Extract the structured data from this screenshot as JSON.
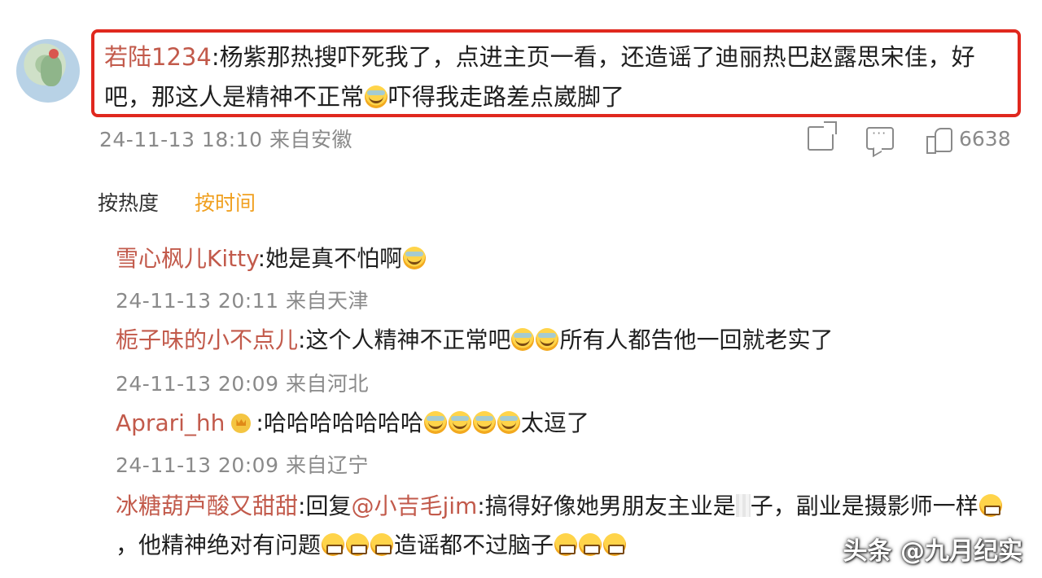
{
  "main_comment": {
    "username": "若陆1234",
    "text": ":杨紫那热搜吓死我了，点进主页一看，还造谣了迪丽热巴赵露思宋佳，好吧，那这人是精神不正常",
    "text_after_emoji": "吓得我走路差点崴脚了",
    "timestamp": "24-11-13 18:10",
    "location": "来自安徽",
    "like_count": "6638"
  },
  "sort": {
    "hot_label": "按热度",
    "time_label": "按时间"
  },
  "replies": [
    {
      "username": "雪心枫儿Kitty",
      "text": ":她是真不怕啊",
      "timestamp": "24-11-13 20:11",
      "location": "来自天津"
    },
    {
      "username": "栀子味的小不点儿",
      "text": ":这个人精神不正常吧",
      "text_after_emoji": "所有人都告他一回就老实了",
      "timestamp": "24-11-13 20:09",
      "location": "来自河北"
    },
    {
      "username": "Aprari_hh",
      "text": ":哈哈哈哈哈哈哈",
      "text_after_emoji": "太逗了",
      "timestamp": "24-11-13 20:09",
      "location": "来自辽宁"
    },
    {
      "username": "冰糖葫芦酸又甜甜",
      "text_part1": ":回复",
      "mention": "@小吉毛jim",
      "text_part2": ":搞得好像她男朋友主业是",
      "text_part3": "子，副业是摄影师一样",
      "text_part4": "，他精神绝对有问题",
      "text_part5": "造谣都不过脑子"
    }
  ],
  "watermark": "头条 @九月纪实",
  "colors": {
    "highlight_border": "#e0281e",
    "username": "#c25a4b",
    "sort_active": "#f0a020",
    "meta_gray": "#8a8a8a"
  },
  "icons": [
    "share-icon",
    "comment-icon",
    "like-icon",
    "crown-badge-icon",
    "laugh-emoji-icon",
    "grin-emoji-icon"
  ]
}
